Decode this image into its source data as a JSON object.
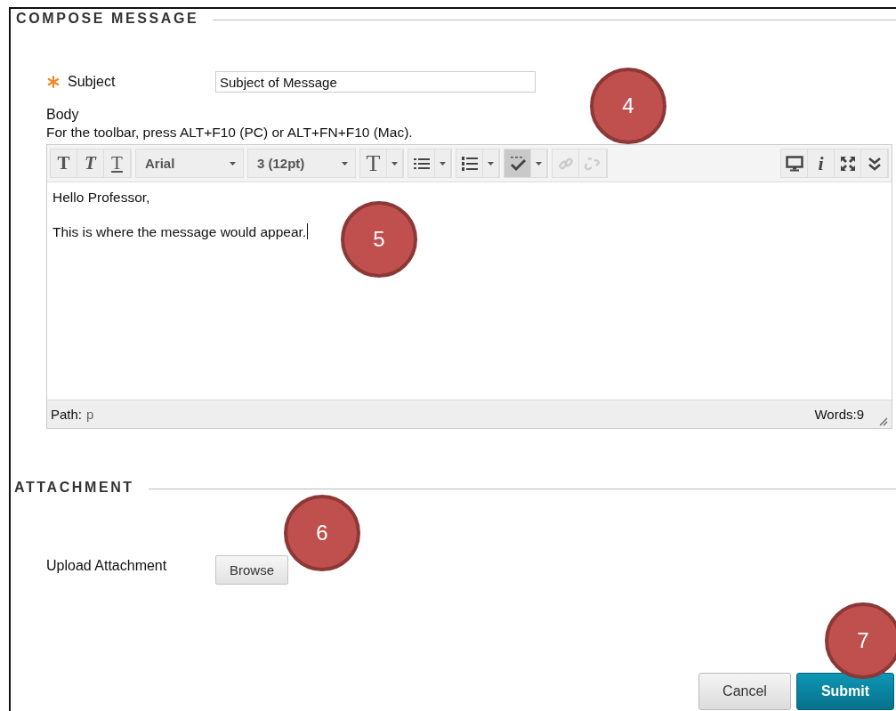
{
  "compose": {
    "heading": "COMPOSE MESSAGE",
    "subject": {
      "label": "Subject",
      "required": true,
      "value": "Subject of Message"
    },
    "body": {
      "label": "Body",
      "hint": "For the toolbar, press ALT+F10 (PC) or ALT+FN+F10 (Mac).",
      "toolbar_left": [
        [
          {
            "kind": "bold",
            "glyph": "T"
          },
          {
            "kind": "italic",
            "glyph": "T"
          },
          {
            "kind": "underline",
            "glyph": "T"
          }
        ],
        [
          {
            "kind": "select",
            "value": "Arial"
          }
        ],
        [
          {
            "kind": "select",
            "value": "3 (12pt)"
          }
        ],
        [
          {
            "kind": "text-color",
            "glyph": "T",
            "dropdown": true
          }
        ],
        [
          {
            "kind": "bullets",
            "dropdown": true
          }
        ],
        [
          {
            "kind": "numbers",
            "dropdown": true
          }
        ],
        [
          {
            "kind": "spellcheck",
            "dropdown": true,
            "on": true
          }
        ],
        [
          {
            "kind": "link",
            "disabled": true
          },
          {
            "kind": "unlink",
            "disabled": true
          }
        ]
      ],
      "toolbar_right": [
        {
          "kind": "preview"
        },
        {
          "kind": "info",
          "glyph": "i"
        },
        {
          "kind": "fullscreen"
        },
        {
          "kind": "more"
        }
      ],
      "paragraphs": [
        "Hello Professor,",
        "This is where the message would appear."
      ],
      "cursor": true,
      "path_label": "Path:",
      "path_value": "p",
      "word_count": "Words:9"
    }
  },
  "attachment": {
    "heading": "ATTACHMENT",
    "label": "Upload Attachment",
    "browse": "Browse"
  },
  "buttons": {
    "cancel": "Cancel",
    "submit": "Submit"
  },
  "callouts": [
    {
      "number": "4"
    },
    {
      "number": "5"
    },
    {
      "number": "6"
    },
    {
      "number": "7"
    }
  ]
}
